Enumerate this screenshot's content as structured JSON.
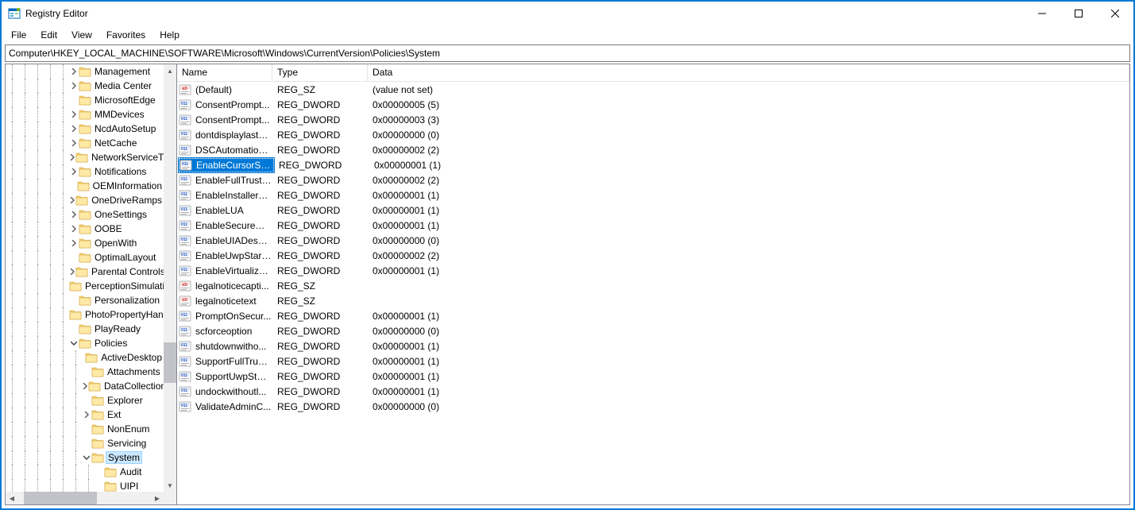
{
  "window": {
    "title": "Registry Editor"
  },
  "menubar": [
    "File",
    "Edit",
    "View",
    "Favorites",
    "Help"
  ],
  "address": "Computer\\HKEY_LOCAL_MACHINE\\SOFTWARE\\Microsoft\\Windows\\CurrentVersion\\Policies\\System",
  "columns": {
    "name": "Name",
    "type": "Type",
    "data": "Data"
  },
  "tree": [
    {
      "depth": 5,
      "twisty": ">",
      "label": "Management"
    },
    {
      "depth": 5,
      "twisty": ">",
      "label": "Media Center"
    },
    {
      "depth": 5,
      "twisty": "",
      "label": "MicrosoftEdge"
    },
    {
      "depth": 5,
      "twisty": ">",
      "label": "MMDevices"
    },
    {
      "depth": 5,
      "twisty": ">",
      "label": "NcdAutoSetup"
    },
    {
      "depth": 5,
      "twisty": ">",
      "label": "NetCache"
    },
    {
      "depth": 5,
      "twisty": ">",
      "label": "NetworkServiceTriggers"
    },
    {
      "depth": 5,
      "twisty": ">",
      "label": "Notifications"
    },
    {
      "depth": 5,
      "twisty": "",
      "label": "OEMInformation"
    },
    {
      "depth": 5,
      "twisty": ">",
      "label": "OneDriveRamps"
    },
    {
      "depth": 5,
      "twisty": ">",
      "label": "OneSettings"
    },
    {
      "depth": 5,
      "twisty": ">",
      "label": "OOBE"
    },
    {
      "depth": 5,
      "twisty": ">",
      "label": "OpenWith"
    },
    {
      "depth": 5,
      "twisty": "",
      "label": "OptimalLayout"
    },
    {
      "depth": 5,
      "twisty": ">",
      "label": "Parental Controls"
    },
    {
      "depth": 5,
      "twisty": "",
      "label": "PerceptionSimulation"
    },
    {
      "depth": 5,
      "twisty": "",
      "label": "Personalization"
    },
    {
      "depth": 5,
      "twisty": "",
      "label": "PhotoPropertyHandler"
    },
    {
      "depth": 5,
      "twisty": "",
      "label": "PlayReady"
    },
    {
      "depth": 5,
      "twisty": "v",
      "label": "Policies"
    },
    {
      "depth": 6,
      "twisty": "",
      "label": "ActiveDesktop"
    },
    {
      "depth": 6,
      "twisty": "",
      "label": "Attachments"
    },
    {
      "depth": 6,
      "twisty": ">",
      "label": "DataCollection"
    },
    {
      "depth": 6,
      "twisty": "",
      "label": "Explorer"
    },
    {
      "depth": 6,
      "twisty": ">",
      "label": "Ext"
    },
    {
      "depth": 6,
      "twisty": "",
      "label": "NonEnum"
    },
    {
      "depth": 6,
      "twisty": "",
      "label": "Servicing"
    },
    {
      "depth": 6,
      "twisty": "v",
      "label": "System",
      "selected": true
    },
    {
      "depth": 7,
      "twisty": "",
      "label": "Audit"
    },
    {
      "depth": 7,
      "twisty": "",
      "label": "UIPI"
    }
  ],
  "values": [
    {
      "icon": "sz",
      "name": "(Default)",
      "type": "REG_SZ",
      "data": "(value not set)"
    },
    {
      "icon": "dw",
      "name": "ConsentPrompt...",
      "type": "REG_DWORD",
      "data": "0x00000005 (5)"
    },
    {
      "icon": "dw",
      "name": "ConsentPrompt...",
      "type": "REG_DWORD",
      "data": "0x00000003 (3)"
    },
    {
      "icon": "dw",
      "name": "dontdisplaylastu...",
      "type": "REG_DWORD",
      "data": "0x00000000 (0)"
    },
    {
      "icon": "dw",
      "name": "DSCAutomation...",
      "type": "REG_DWORD",
      "data": "0x00000002 (2)"
    },
    {
      "icon": "dw",
      "name": "EnableCursorSu...",
      "type": "REG_DWORD",
      "data": "0x00000001 (1)",
      "selected": true
    },
    {
      "icon": "dw",
      "name": "EnableFullTrustS...",
      "type": "REG_DWORD",
      "data": "0x00000002 (2)"
    },
    {
      "icon": "dw",
      "name": "EnableInstallerD...",
      "type": "REG_DWORD",
      "data": "0x00000001 (1)"
    },
    {
      "icon": "dw",
      "name": "EnableLUA",
      "type": "REG_DWORD",
      "data": "0x00000001 (1)"
    },
    {
      "icon": "dw",
      "name": "EnableSecureUI...",
      "type": "REG_DWORD",
      "data": "0x00000001 (1)"
    },
    {
      "icon": "dw",
      "name": "EnableUIADeskt...",
      "type": "REG_DWORD",
      "data": "0x00000000 (0)"
    },
    {
      "icon": "dw",
      "name": "EnableUwpStart...",
      "type": "REG_DWORD",
      "data": "0x00000002 (2)"
    },
    {
      "icon": "dw",
      "name": "EnableVirtualizat...",
      "type": "REG_DWORD",
      "data": "0x00000001 (1)"
    },
    {
      "icon": "sz",
      "name": "legalnoticecapti...",
      "type": "REG_SZ",
      "data": ""
    },
    {
      "icon": "sz",
      "name": "legalnoticetext",
      "type": "REG_SZ",
      "data": ""
    },
    {
      "icon": "dw",
      "name": "PromptOnSecur...",
      "type": "REG_DWORD",
      "data": "0x00000001 (1)"
    },
    {
      "icon": "dw",
      "name": "scforceoption",
      "type": "REG_DWORD",
      "data": "0x00000000 (0)"
    },
    {
      "icon": "dw",
      "name": "shutdownwitho...",
      "type": "REG_DWORD",
      "data": "0x00000001 (1)"
    },
    {
      "icon": "dw",
      "name": "SupportFullTrust...",
      "type": "REG_DWORD",
      "data": "0x00000001 (1)"
    },
    {
      "icon": "dw",
      "name": "SupportUwpStar...",
      "type": "REG_DWORD",
      "data": "0x00000001 (1)"
    },
    {
      "icon": "dw",
      "name": "undockwithoutl...",
      "type": "REG_DWORD",
      "data": "0x00000001 (1)"
    },
    {
      "icon": "dw",
      "name": "ValidateAdminC...",
      "type": "REG_DWORD",
      "data": "0x00000000 (0)"
    }
  ]
}
